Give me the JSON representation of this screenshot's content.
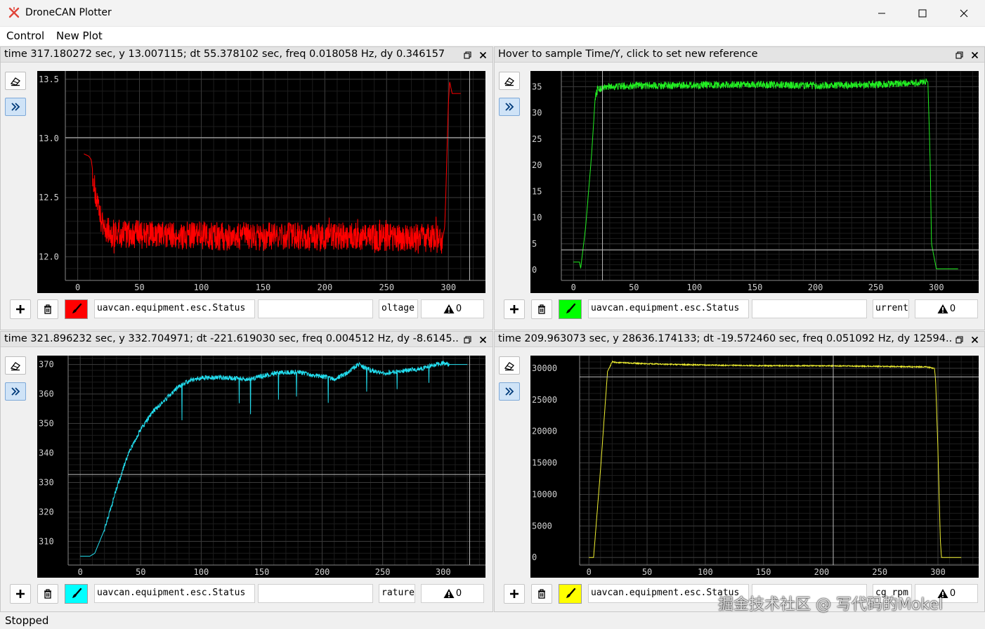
{
  "window": {
    "title": "DroneCAN Plotter"
  },
  "menu": [
    "Control",
    "New Plot"
  ],
  "status": "Stopped",
  "watermark": "掘金技术社区 @ 写代码的Mokel",
  "panels": [
    {
      "header": "time 317.180272 sec,  y 13.007115;    dt 55.378102 sec,  freq 0.018058 Hz,  dy 0.346157",
      "message": "uavcan.equipment.esc.Status",
      "expression": "",
      "field": "oltage",
      "warnings": "0",
      "color": "#ff0000",
      "chart_data": {
        "type": "line",
        "series_color": "#ff0000",
        "xlim": [
          -10,
          330
        ],
        "ylim": [
          11.8,
          13.57
        ],
        "xticks": [
          0,
          50,
          100,
          150,
          200,
          250,
          300
        ],
        "xticklabels": [
          "0",
          "50",
          "100",
          "150",
          "200",
          "250",
          "300"
        ],
        "yticks": [
          12.0,
          12.5,
          13.0,
          13.5
        ],
        "yticklabels": [
          "12.0",
          "12.5",
          "13.0",
          "13.5"
        ],
        "x": [
          5,
          7,
          9,
          11,
          12,
          14,
          17,
          20,
          25,
          30,
          40,
          50,
          60,
          80,
          100,
          120,
          140,
          160,
          180,
          200,
          220,
          240,
          260,
          280,
          290,
          295,
          297,
          298,
          299,
          300,
          301,
          303,
          310
        ],
        "y": [
          12.87,
          12.86,
          12.85,
          12.82,
          12.73,
          12.55,
          12.37,
          12.27,
          12.22,
          12.2,
          12.19,
          12.19,
          12.18,
          12.18,
          12.18,
          12.17,
          12.17,
          12.17,
          12.17,
          12.17,
          12.17,
          12.16,
          12.16,
          12.16,
          12.15,
          12.14,
          12.25,
          12.55,
          12.95,
          13.3,
          13.48,
          13.38,
          13.38
        ],
        "noise": 0.12,
        "noise_range": [
          12,
          295
        ],
        "crosshair": {
          "x": 317.18,
          "y": 13.007
        }
      }
    },
    {
      "header": "Hover to sample Time/Y, click to set new reference",
      "message": "uavcan.equipment.esc.Status",
      "expression": "",
      "field": "urrent",
      "warnings": "0",
      "color": "#00ff00",
      "chart_data": {
        "type": "line",
        "series_color": "#22ee22",
        "xlim": [
          -10,
          335
        ],
        "ylim": [
          -2,
          38
        ],
        "xticks": [
          0,
          50,
          100,
          150,
          200,
          250,
          300
        ],
        "xticklabels": [
          "0",
          "50",
          "100",
          "150",
          "200",
          "250",
          "300"
        ],
        "yticks": [
          0,
          5,
          10,
          15,
          20,
          25,
          30,
          35
        ],
        "yticklabels": [
          "0",
          "5",
          "10",
          "15",
          "20",
          "25",
          "30",
          "35"
        ],
        "x": [
          0,
          5,
          6,
          10,
          15,
          18,
          20,
          25,
          30,
          50,
          100,
          150,
          200,
          250,
          280,
          290,
          293,
          295,
          296,
          300,
          318
        ],
        "y": [
          1.5,
          1.5,
          0.3,
          8,
          22,
          33,
          34.5,
          34.8,
          35,
          35.2,
          35.3,
          35.4,
          35.2,
          35.4,
          35.6,
          35.8,
          36,
          20,
          5,
          0.2,
          0.2
        ],
        "noise": 0.7,
        "noise_range": [
          18,
          292
        ],
        "crosshair": {
          "x": 24,
          "y": 3.8
        }
      }
    },
    {
      "header": "time 321.896232 sec,  y 332.704971;    dt -221.619030 sec,  freq 0.004512 Hz,  dy -8.6145..",
      "message": "uavcan.equipment.esc.Status",
      "expression": "",
      "field": "rature",
      "warnings": "0",
      "color": "#00ffff",
      "chart_data": {
        "type": "line",
        "series_color": "#22ddee",
        "xlim": [
          -10,
          335
        ],
        "ylim": [
          302,
          373
        ],
        "xticks": [
          0,
          50,
          100,
          150,
          200,
          250,
          300
        ],
        "xticklabels": [
          "0",
          "50",
          "100",
          "150",
          "200",
          "250",
          "300"
        ],
        "yticks": [
          310,
          320,
          330,
          340,
          350,
          360,
          370
        ],
        "yticklabels": [
          "310",
          "320",
          "330",
          "340",
          "350",
          "360",
          "370"
        ],
        "x": [
          0,
          8,
          12,
          20,
          30,
          40,
          50,
          60,
          70,
          80,
          90,
          100,
          120,
          140,
          150,
          160,
          180,
          190,
          200,
          210,
          220,
          230,
          240,
          250,
          260,
          270,
          280,
          290,
          300,
          304,
          320
        ],
        "y": [
          305,
          305,
          306,
          314,
          328,
          340,
          348,
          354,
          358,
          362,
          364.5,
          365.5,
          365.5,
          365,
          366,
          367,
          367.5,
          366.5,
          366,
          365,
          367,
          370,
          368,
          367,
          367.5,
          368,
          368.5,
          369.5,
          370.5,
          370,
          370
        ],
        "noise": 0.8,
        "noise_range": [
          20,
          305
        ],
        "crosshair": {
          "x": 321.9,
          "y": 332.7
        }
      }
    },
    {
      "header": "time 209.963073 sec,  y 28636.174133;    dt -19.572460 sec,  freq 0.051092 Hz,  dy 12594..",
      "message": "uavcan.equipment.esc.Status",
      "expression": "",
      "field": "cg_rpm",
      "warnings": "0",
      "color": "#ffff00",
      "chart_data": {
        "type": "line",
        "series_color": "#f0f030",
        "xlim": [
          -8,
          335
        ],
        "ylim": [
          -1200,
          32000
        ],
        "xticks": [
          0,
          50,
          100,
          150,
          200,
          250,
          300
        ],
        "xticklabels": [
          "0",
          "50",
          "100",
          "150",
          "200",
          "250",
          "300"
        ],
        "yticks": [
          0,
          5000,
          10000,
          15000,
          20000,
          25000,
          30000
        ],
        "yticklabels": [
          "0",
          "5000",
          "10000",
          "15000",
          "20000",
          "25000",
          "30000"
        ],
        "x": [
          0,
          3,
          4,
          10,
          16,
          20,
          25,
          50,
          100,
          150,
          200,
          250,
          290,
          297,
          298,
          300,
          302,
          303,
          320
        ],
        "y": [
          0,
          0,
          0,
          14000,
          29500,
          31000,
          30900,
          30700,
          30500,
          30400,
          30400,
          30300,
          30200,
          30000,
          28000,
          17000,
          3000,
          0,
          0
        ],
        "noise": 90,
        "noise_range": [
          18,
          296
        ],
        "crosshair": {
          "x": 210,
          "y": 28636
        }
      }
    }
  ]
}
